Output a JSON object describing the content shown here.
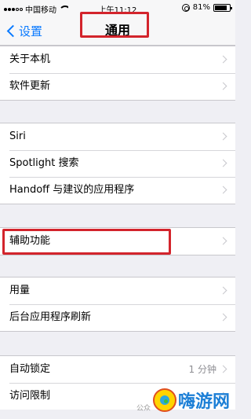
{
  "status_bar": {
    "carrier": "中国移动",
    "time": "上午11:12",
    "battery": "81%",
    "battery_level": 0.81
  },
  "nav": {
    "back_label": "设置",
    "title": "通用"
  },
  "groups": [
    [
      {
        "label": "关于本机",
        "value": ""
      },
      {
        "label": "软件更新",
        "value": ""
      }
    ],
    [
      {
        "label": "Siri",
        "value": ""
      },
      {
        "label": "Spotlight 搜索",
        "value": ""
      },
      {
        "label": "Handoff 与建议的应用程序",
        "value": ""
      }
    ],
    [
      {
        "label": "辅助功能",
        "value": ""
      }
    ],
    [
      {
        "label": "用量",
        "value": ""
      },
      {
        "label": "后台应用程序刷新",
        "value": ""
      }
    ],
    [
      {
        "label": "自动锁定",
        "value": "1 分钟"
      },
      {
        "label": "访问限制",
        "value": ""
      }
    ]
  ],
  "watermark": {
    "text": "公众",
    "brand": "嗨游网"
  },
  "colors": {
    "accent": "#0a7aff",
    "highlight": "#d3242c"
  }
}
